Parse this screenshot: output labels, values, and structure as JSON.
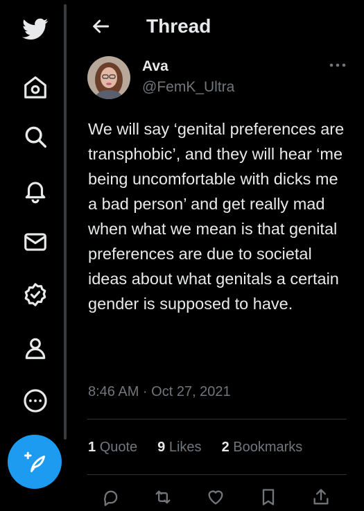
{
  "nav": {
    "icons": [
      "twitter-logo",
      "home-icon",
      "search-icon",
      "notifications-icon",
      "messages-icon",
      "verified-icon",
      "profile-icon",
      "more-icon"
    ],
    "compose_icon": "compose-icon"
  },
  "header": {
    "title": "Thread",
    "back_icon": "back-arrow-icon"
  },
  "tweet": {
    "author_name": "Ava",
    "author_handle": "@FemK_Ultra",
    "text": "We will say ‘genital preferences are transphobic’, and they will hear ‘me being uncomfortable with dicks me a bad person’ and get really mad when what we mean is that genital preferences are due to societal ideas about what genitals a certain gender is supposed to have.",
    "timestamp": "8:46 AM · Oct 27, 2021",
    "stats": {
      "quotes_count": "1",
      "quotes_label": "Quote",
      "likes_count": "9",
      "likes_label": "Likes",
      "bookmarks_count": "2",
      "bookmarks_label": "Bookmarks"
    }
  },
  "colors": {
    "accent": "#1d9bf0",
    "background": "#000000",
    "muted": "#71767b",
    "text": "#e7e9ea"
  }
}
